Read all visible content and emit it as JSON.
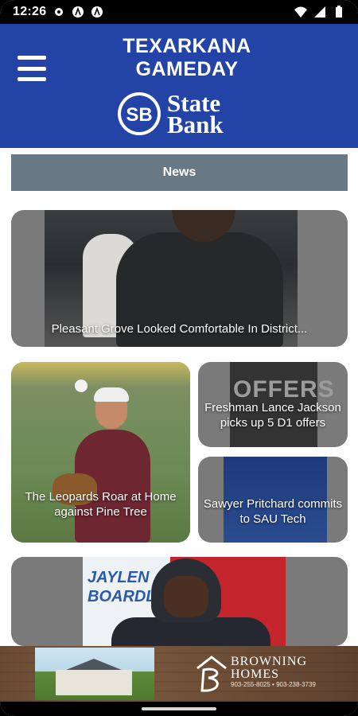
{
  "status_bar": {
    "time": "12:26",
    "icons": [
      "settings-icon",
      "app-a-icon",
      "app-a-icon",
      "wifi-icon",
      "signal-icon",
      "battery-icon"
    ]
  },
  "header": {
    "title_line1": "TEXARKANA",
    "title_line2": "GAMEDAY",
    "sponsor_logo_mark": "SB",
    "sponsor_line1": "State",
    "sponsor_line2": "Bank",
    "background_color": "#2344a6"
  },
  "section": {
    "label": "News",
    "color": "#687885"
  },
  "articles": [
    {
      "title": "Pleasant Grove Looked Comfortable In District..."
    },
    {
      "title": "The Leopards Roar at Home against Pine Tree"
    },
    {
      "title": "Freshman Lance Jackson picks up 5 D1 offers",
      "image_text": "OFFERS"
    },
    {
      "title": "Sawyer Pritchard commits to SAU Tech"
    },
    {
      "title": "",
      "image_text_line1": "JAYLEN",
      "image_text_line2": "BOARDLEY"
    }
  ],
  "ad": {
    "brand_line1": "BROWNING",
    "brand_line2": "HOMES",
    "contact": "903-255-8025 • 903-238-3739"
  }
}
